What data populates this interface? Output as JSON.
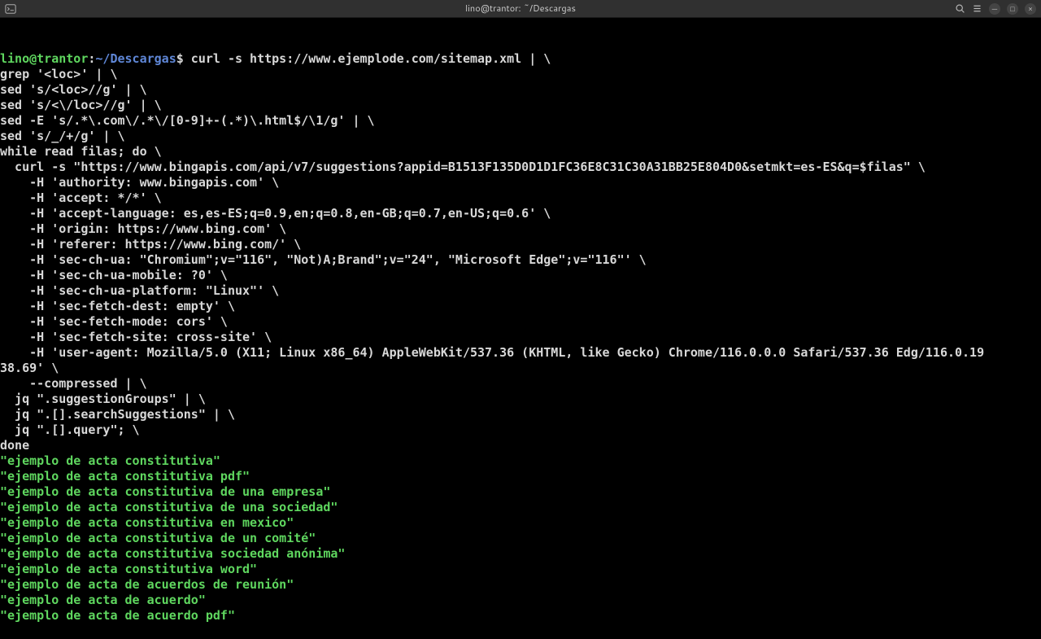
{
  "titlebar": {
    "title": "lino@trantor: ~/Descargas"
  },
  "prompt": {
    "userhost": "lino@trantor",
    "colon": ":",
    "path": "~/Descargas",
    "dollar": "$"
  },
  "cmd_lines": [
    " curl -s https://www.ejemplode.com/sitemap.xml | \\",
    "grep '<loc>' | \\",
    "sed 's/<loc>//g' | \\",
    "sed 's/<\\/loc>//g' | \\",
    "sed -E 's/.*\\.com\\/.*\\/[0-9]+-(.*)\\.html$/\\1/g' | \\",
    "sed 's/_/+/g' | \\",
    "while read filas; do \\",
    "  curl -s \"https://www.bingapis.com/api/v7/suggestions?appid=B1513F135D0D1D1FC36E8C31C30A31BB25E804D0&setmkt=es-ES&q=$filas\" \\",
    "    -H 'authority: www.bingapis.com' \\",
    "    -H 'accept: */*' \\",
    "    -H 'accept-language: es,es-ES;q=0.9,en;q=0.8,en-GB;q=0.7,en-US;q=0.6' \\",
    "    -H 'origin: https://www.bing.com' \\",
    "    -H 'referer: https://www.bing.com/' \\",
    "    -H 'sec-ch-ua: \"Chromium\";v=\"116\", \"Not)A;Brand\";v=\"24\", \"Microsoft Edge\";v=\"116\"' \\",
    "    -H 'sec-ch-ua-mobile: ?0' \\",
    "    -H 'sec-ch-ua-platform: \"Linux\"' \\",
    "    -H 'sec-fetch-dest: empty' \\",
    "    -H 'sec-fetch-mode: cors' \\",
    "    -H 'sec-fetch-site: cross-site' \\",
    "    -H 'user-agent: Mozilla/5.0 (X11; Linux x86_64) AppleWebKit/537.36 (KHTML, like Gecko) Chrome/116.0.0.0 Safari/537.36 Edg/116.0.19",
    "38.69' \\",
    "    --compressed | \\",
    "  jq \".suggestionGroups\" | \\",
    "  jq \".[].searchSuggestions\" | \\",
    "  jq \".[].query\"; \\",
    "done"
  ],
  "output_lines": [
    "\"ejemplo de acta constitutiva\"",
    "\"ejemplo de acta constitutiva pdf\"",
    "\"ejemplo de acta constitutiva de una empresa\"",
    "\"ejemplo de acta constitutiva de una sociedad\"",
    "\"ejemplo de acta constitutiva en mexico\"",
    "\"ejemplo de acta constitutiva de un comité\"",
    "\"ejemplo de acta constitutiva sociedad anónima\"",
    "\"ejemplo de acta constitutiva word\"",
    "\"ejemplo de acta de acuerdos de reunión\"",
    "\"ejemplo de acta de acuerdo\"",
    "\"ejemplo de acta de acuerdo pdf\""
  ]
}
